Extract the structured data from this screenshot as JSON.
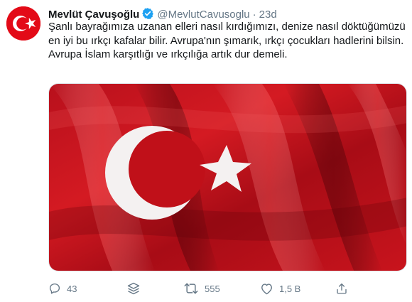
{
  "author": {
    "name": "Mevlüt Çavuşoğlu",
    "handle": "@MevlutCavusoglu",
    "separator": "·",
    "time": "23d",
    "avatar_icon": "turkish-flag-icon",
    "verified_icon": "verified-badge-icon"
  },
  "tweet": {
    "lines": [
      "Şanlı bayrağımıza uzanan elleri nasıl kırdığımızı, denize nasıl döktüğümüzü",
      "en iyi bu ırkçı kafalar bilir. Avrupa'nın şımarık, ırkçı çocukları hadlerini bilsin.",
      "Avrupa İslam karşıtlığı ve ırkçılığa artık dur demeli."
    ],
    "media": "turkish-flag-image"
  },
  "actions": {
    "replies": "43",
    "retweets": "555",
    "likes": "1,5 B",
    "icons": [
      "reply-icon",
      "stack-icon",
      "retweet-icon",
      "like-icon",
      "share-icon"
    ]
  },
  "colors": {
    "flag_red": "#e30a17",
    "verified_blue": "#1da1f2",
    "muted": "#657786"
  }
}
